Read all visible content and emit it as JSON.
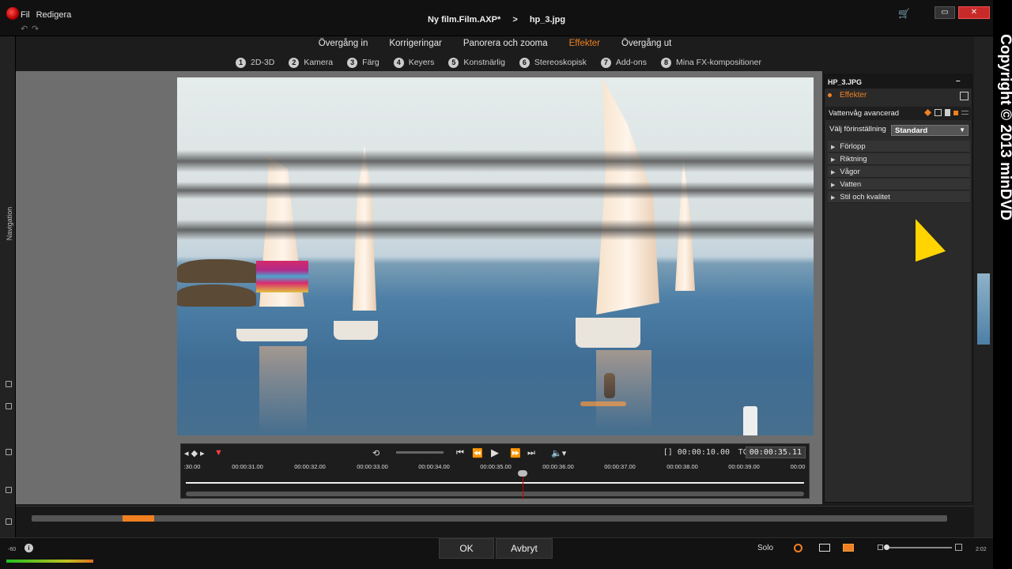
{
  "menu": {
    "items": [
      "Fil",
      "Redigera"
    ]
  },
  "document": {
    "project": "Ny film.Film.AXP*",
    "separator": ">",
    "file": "hp_3.jpg"
  },
  "main_tabs": [
    {
      "label": "Övergång in",
      "active": false
    },
    {
      "label": "Korrigeringar",
      "active": false
    },
    {
      "label": "Panorera och zooma",
      "active": false
    },
    {
      "label": "Effekter",
      "active": true
    },
    {
      "label": "Övergång ut",
      "active": false
    }
  ],
  "sub_tabs": [
    {
      "num": "1",
      "label": "2D-3D"
    },
    {
      "num": "2",
      "label": "Kamera"
    },
    {
      "num": "3",
      "label": "Färg"
    },
    {
      "num": "4",
      "label": "Keyers"
    },
    {
      "num": "5",
      "label": "Konstnärlig"
    },
    {
      "num": "6",
      "label": "Stereoskopisk"
    },
    {
      "num": "7",
      "label": "Add-ons"
    },
    {
      "num": "8",
      "label": "Mina FX-kompositioner"
    }
  ],
  "sidebar": {
    "navigation_label": "Navigation"
  },
  "transport": {
    "duration_tc": "[] 00:00:10.00",
    "tc_label": "TC",
    "current_tc": "00:00:35.11",
    "ruler_ticks": [
      ":30.00",
      "00:00:31.00",
      "00:00:32.00",
      "00:00:33.00",
      "00:00:34.00",
      "00:00:35.00",
      "00:00:36.00",
      "00:00:37.00",
      "00:00:38.00",
      "00:00:39.00",
      "00:00"
    ]
  },
  "panel": {
    "title": "HP_3.JPG",
    "effects_label": "Effekter",
    "effect_name": "Vattenvåg avancerad",
    "preset_label": "Välj förinställning",
    "preset_value": "Standard",
    "groups": [
      "Förlopp",
      "Riktning",
      "Vågor",
      "Vatten",
      "Stil och kvalitet"
    ]
  },
  "bottom": {
    "ok": "OK",
    "cancel": "Avbryt",
    "solo": "Solo",
    "time_left": "-60",
    "time_right": "2:02"
  },
  "copyright": "Copyright © 2013 minDVD",
  "colors": {
    "accent": "#f08020",
    "close": "#c82a2a",
    "cursor": "#ffd400"
  }
}
